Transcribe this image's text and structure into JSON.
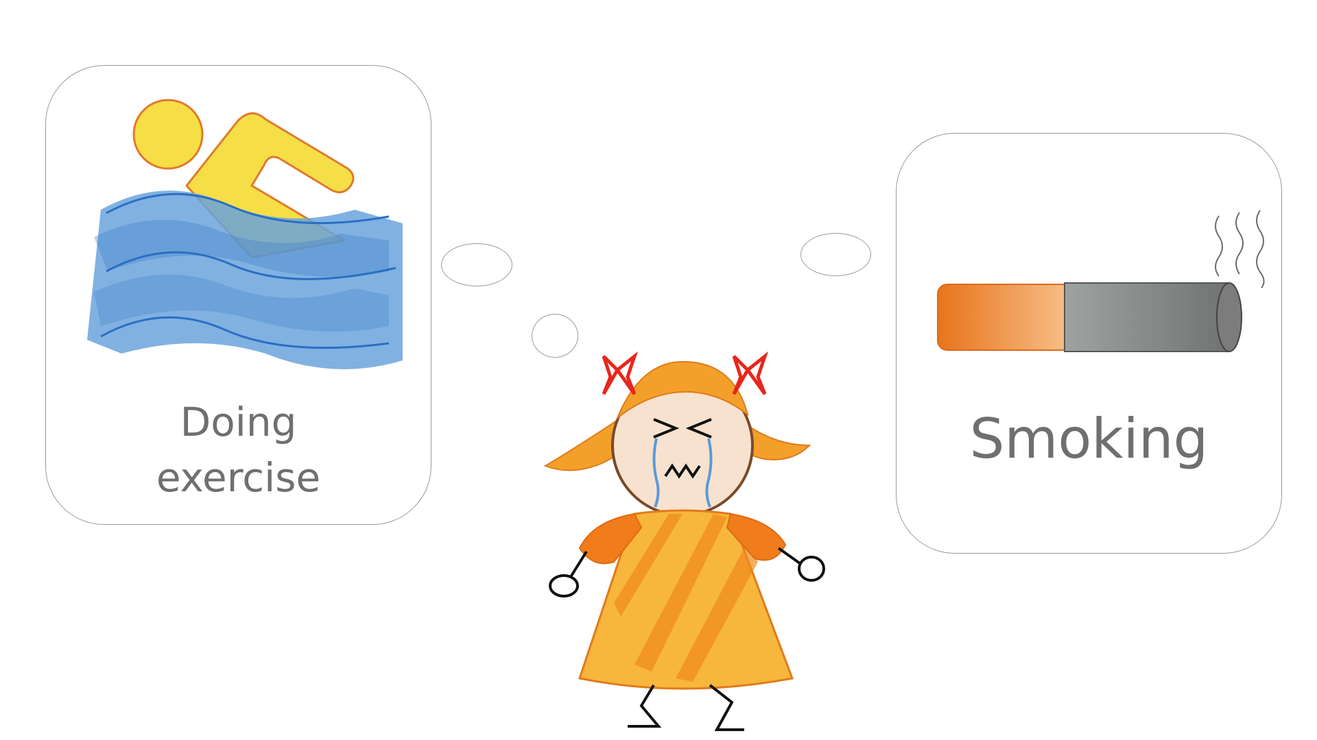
{
  "left_card": {
    "label": "Doing exercise",
    "icon": "swimming-icon",
    "colors": {
      "swimmer": "#f6de46",
      "outline": "#e07a2a",
      "water": "#6aa3dc",
      "water_line": "#2a6fc4"
    }
  },
  "right_card": {
    "label": "Smoking",
    "icon": "cigarette-icon",
    "colors": {
      "filter": "#f0a162",
      "ash": "#8d918f",
      "smoke": "#6b6b6b"
    }
  },
  "character": {
    "icon": "crying-girl-icon",
    "colors": {
      "hair": "#f3a02a",
      "bows": "#e8261d",
      "dress": "#f7b63c",
      "sleeves": "#f07c1c",
      "face": "#f7e2cf",
      "tears": "#5b9bd5"
    }
  }
}
